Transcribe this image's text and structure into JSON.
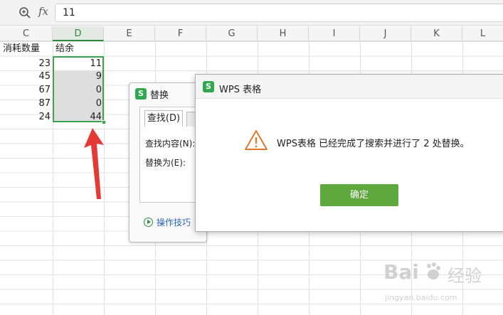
{
  "formula_bar": {
    "zoom_icon": "magnifier-zoom-icon",
    "fx_label": "fx",
    "value": "11"
  },
  "columns": [
    "C",
    "D",
    "E",
    "F",
    "G",
    "H",
    "I",
    "J",
    "K",
    "L"
  ],
  "active_column": "D",
  "cells": {
    "c_header": "消耗数量",
    "d_header": "结余",
    "c_values": [
      "23",
      "45",
      "67",
      "87",
      "24"
    ],
    "d_values": [
      "11",
      "9",
      "0",
      "0",
      "44"
    ]
  },
  "replace_dialog": {
    "title": "替换",
    "tab_find": "查找(D)",
    "find_label": "查找内容(N):",
    "replace_label": "替换为(E):",
    "tips_link": "操作技巧",
    "icon": "wps-logo-icon"
  },
  "message_box": {
    "title": "WPS 表格",
    "message": "WPS表格 已经完成了搜索并进行了 2 处替换。",
    "ok_label": "确定",
    "icon": "warning-triangle-icon"
  },
  "watermark": {
    "brand": "Bai",
    "brand_cn": "经验",
    "url": "jingyan.baidu.com"
  },
  "colors": {
    "accent_green": "#3ea34e",
    "button_green": "#5fa83d",
    "arrow_red": "#e53935",
    "link_blue": "#2867b2",
    "warning_orange": "#e07a2b"
  }
}
